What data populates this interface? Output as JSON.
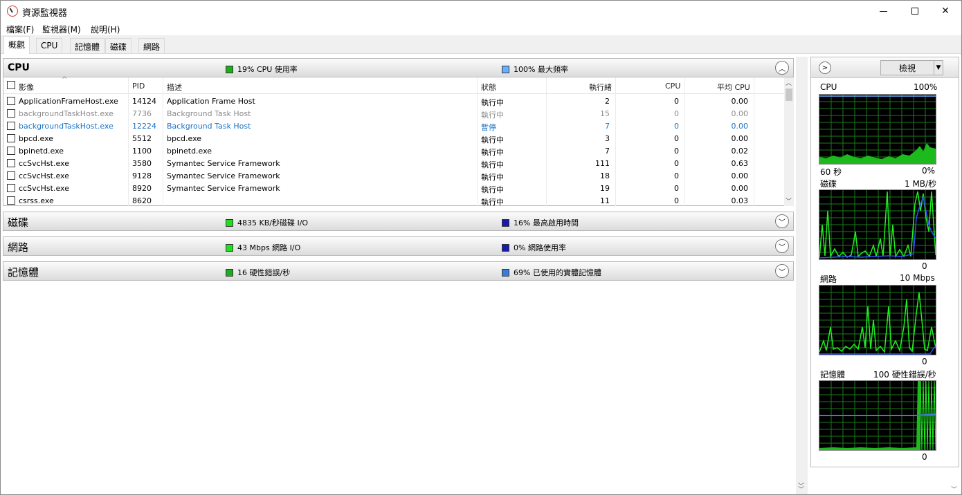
{
  "window": {
    "title": "資源監視器"
  },
  "menu": [
    "檔案(F)",
    "監視器(M)",
    "說明(H)"
  ],
  "tabs": [
    "概觀",
    "CPU",
    "記憶體",
    "磁碟",
    "網路"
  ],
  "cpu_section": {
    "title": "CPU",
    "legend1": "19% CPU 使用率",
    "legend2": "100% 最大頻率",
    "legend1_color": "#1faa1f",
    "legend2_color": "#6ab0ff",
    "columns": [
      "影像",
      "PID",
      "描述",
      "狀態",
      "執行緒",
      "CPU",
      "平均 CPU"
    ],
    "rows": [
      {
        "image": "ApplicationFrameHost.exe",
        "pid": "14124",
        "desc": "Application Frame Host",
        "status": "執行中",
        "threads": "2",
        "cpu": "0",
        "avg": "0.00"
      },
      {
        "image": "backgroundTaskHost.exe",
        "pid": "7736",
        "desc": "Background Task Host",
        "status": "執行中",
        "threads": "15",
        "cpu": "0",
        "avg": "0.00"
      },
      {
        "image": "backgroundTaskHost.exe",
        "pid": "12224",
        "desc": "Background Task Host",
        "status": "暫停",
        "threads": "7",
        "cpu": "0",
        "avg": "0.00"
      },
      {
        "image": "bpcd.exe",
        "pid": "5512",
        "desc": "bpcd.exe",
        "status": "執行中",
        "threads": "3",
        "cpu": "0",
        "avg": "0.00"
      },
      {
        "image": "bpinetd.exe",
        "pid": "1100",
        "desc": "bpinetd.exe",
        "status": "執行中",
        "threads": "7",
        "cpu": "0",
        "avg": "0.02"
      },
      {
        "image": "ccSvcHst.exe",
        "pid": "3580",
        "desc": "Symantec Service Framework",
        "status": "執行中",
        "threads": "111",
        "cpu": "0",
        "avg": "0.63"
      },
      {
        "image": "ccSvcHst.exe",
        "pid": "9128",
        "desc": "Symantec Service Framework",
        "status": "執行中",
        "threads": "18",
        "cpu": "0",
        "avg": "0.00"
      },
      {
        "image": "ccSvcHst.exe",
        "pid": "8920",
        "desc": "Symantec Service Framework",
        "status": "執行中",
        "threads": "19",
        "cpu": "0",
        "avg": "0.00"
      },
      {
        "image": "csrss.exe",
        "pid": "8620",
        "desc": "",
        "status": "執行中",
        "threads": "11",
        "cpu": "0",
        "avg": "0.03"
      }
    ]
  },
  "disk_section": {
    "title": "磁碟",
    "legend1": "4835 KB/秒磁碟 I/O",
    "legend2": "16% 最高啟用時間",
    "legend1_color": "#22dd22",
    "legend2_color": "#1a1aa8"
  },
  "network_section": {
    "title": "網路",
    "legend1": "43 Mbps 網路 I/O",
    "legend2": "0% 網路使用率",
    "legend1_color": "#22dd22",
    "legend2_color": "#1a1aa8"
  },
  "memory_section": {
    "title": "記憶體",
    "legend1": "16 硬性錯誤/秒",
    "legend2": "69% 已使用的實體記憶體",
    "legend1_color": "#1faa1f",
    "legend2_color": "#3a7bd5"
  },
  "right_pane": {
    "view_label": "檢視",
    "cpu_label": "CPU",
    "cpu_max": "100%",
    "cpu_time": "60 秒",
    "cpu_min": "0%",
    "disk_label": "磁碟",
    "disk_max": "1 MB/秒",
    "disk_min": "0",
    "net_label": "網路",
    "net_max": "10 Mbps",
    "net_min": "0",
    "mem_label": "記憶體",
    "mem_max": "100 硬性錯誤/秒",
    "mem_min": "0"
  }
}
